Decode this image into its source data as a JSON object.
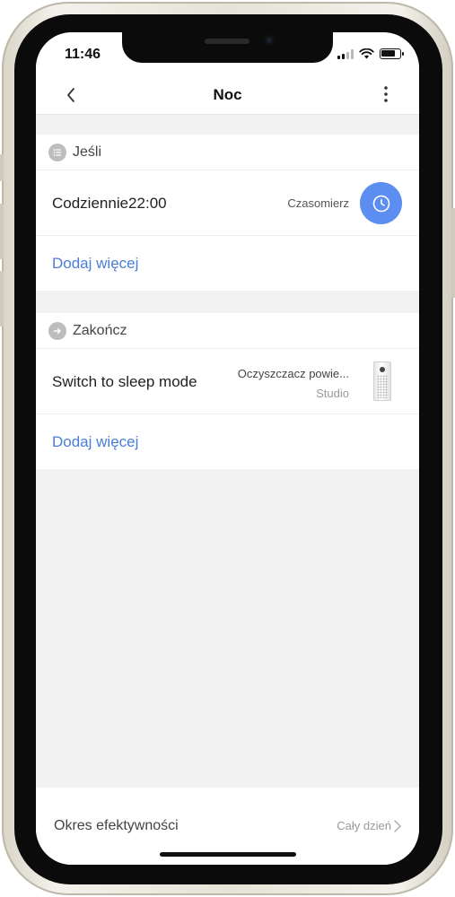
{
  "status_bar": {
    "time": "11:46",
    "icons": [
      "cellular-signal-icon",
      "wifi-icon",
      "battery-icon"
    ]
  },
  "header": {
    "title": "Noc",
    "back_icon": "chevron-left-icon",
    "more_icon": "more-vertical-icon"
  },
  "if_section": {
    "label": "Jeśli",
    "icon": "list-icon",
    "condition": {
      "label": "Codziennie22:00",
      "type": "Czasomierz",
      "icon": "clock-icon"
    },
    "add_more": "Dodaj więcej"
  },
  "then_section": {
    "label": "Zakończ",
    "icon": "arrow-right-icon",
    "action": {
      "label": "Switch to sleep mode",
      "device_name": "Oczyszczacz powie...",
      "device_room": "Studio",
      "device_icon": "air-purifier-icon"
    },
    "add_more": "Dodaj więcej"
  },
  "footer": {
    "label": "Okres efektywności",
    "value": "Cały dzień",
    "icon": "chevron-right-icon"
  },
  "colors": {
    "accent": "#5b8ef0",
    "link": "#4a7ed8",
    "background": "#f2f2f2"
  }
}
